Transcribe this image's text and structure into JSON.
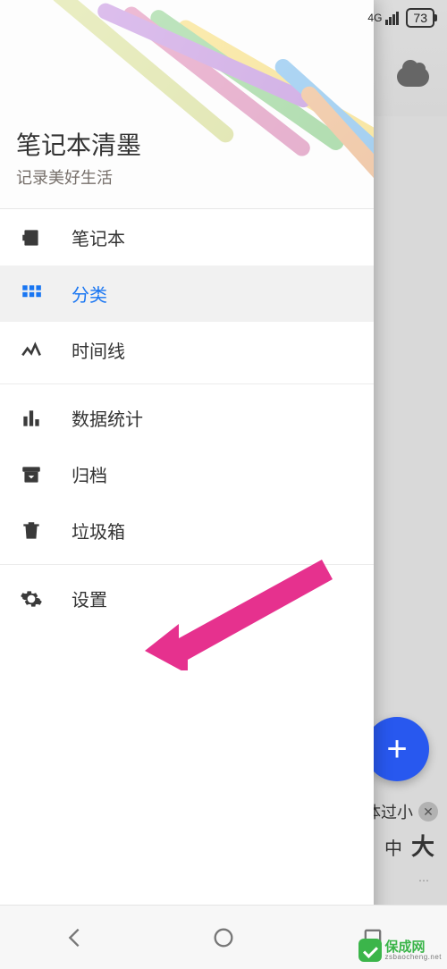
{
  "status": {
    "network_label": "4G",
    "battery": "73"
  },
  "drawer": {
    "title": "笔记本清墨",
    "subtitle": "记录美好生活",
    "items": [
      {
        "icon": "notebook-icon",
        "label": "笔记本"
      },
      {
        "icon": "grid-icon",
        "label": "分类",
        "active": true
      },
      {
        "icon": "timeline-icon",
        "label": "时间线"
      },
      {
        "icon": "stats-icon",
        "label": "数据统计"
      },
      {
        "icon": "archive-icon",
        "label": "归档"
      },
      {
        "icon": "trash-icon",
        "label": "垃圾箱"
      },
      {
        "icon": "gear-icon",
        "label": "设置"
      }
    ]
  },
  "fab": {
    "glyph": "+"
  },
  "bottom_hint": {
    "line1": "体过小",
    "line2_mid": "中",
    "line2_big": "大"
  },
  "watermark": {
    "name": "保成网",
    "url": "zsbaocheng.net"
  }
}
